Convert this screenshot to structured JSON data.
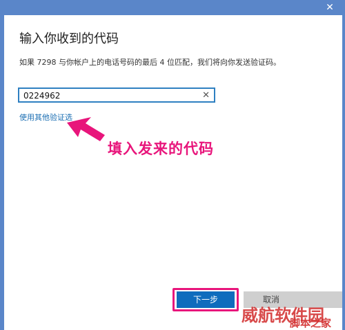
{
  "window": {
    "close_glyph": "✕"
  },
  "dialog": {
    "title": "输入你收到的代码",
    "description": "如果 7298 与你帐户上的电话号码的最后 4 位匹配，我们将向你发送验证码。",
    "code_input": {
      "value": "0224962",
      "clear_glyph": "✕"
    },
    "alt_link": "使用其他验证选"
  },
  "annotation": {
    "text": "填入发来的代码",
    "color": "#e8157b"
  },
  "buttons": {
    "next": "下一步",
    "cancel": "取消"
  },
  "watermark": {
    "line1": "威航软件园",
    "line2": "脚本之家"
  }
}
